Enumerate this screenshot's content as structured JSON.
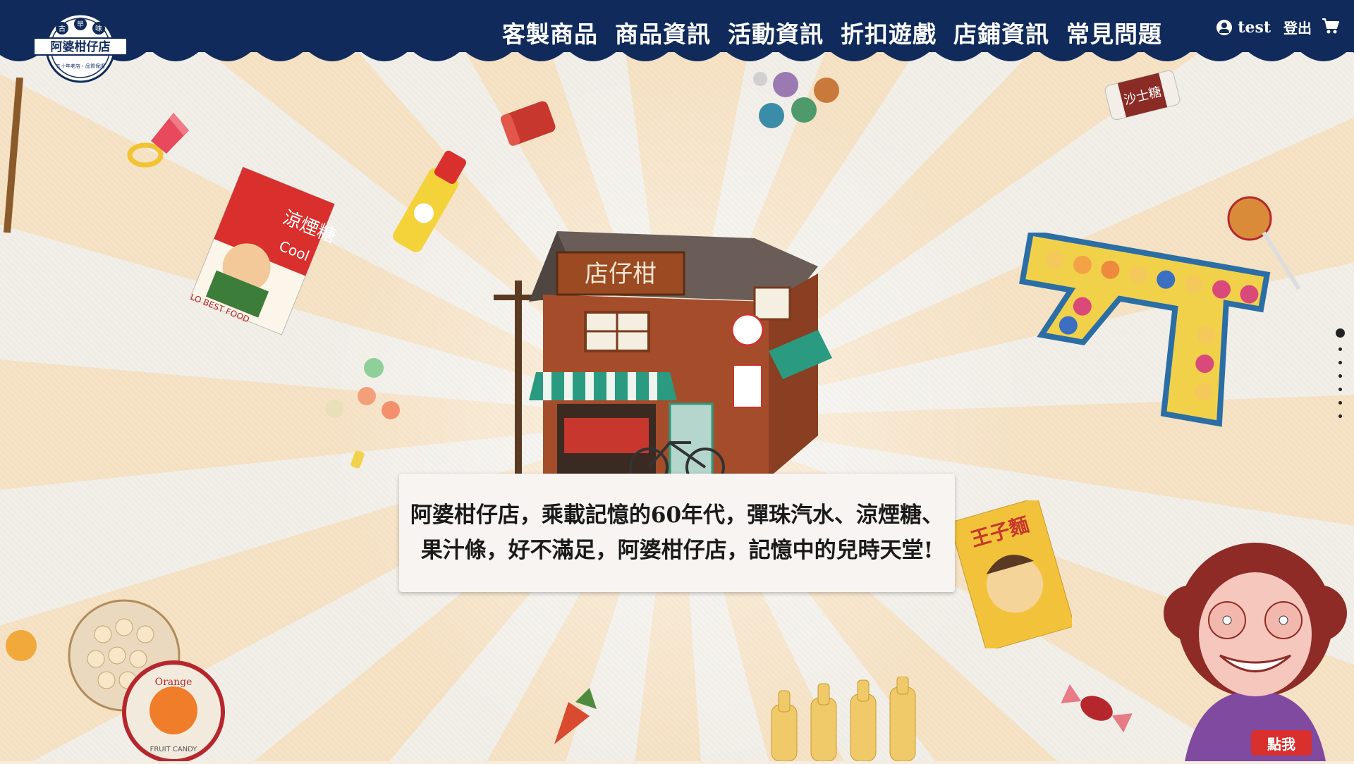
{
  "brand": {
    "logo_top_char_left": "古",
    "logo_top_char_mid": "早",
    "logo_top_char_right": "味",
    "logo_name": "阿婆柑仔店",
    "logo_tagline": "五十年老店・品質保證"
  },
  "nav": {
    "items": [
      "客製商品",
      "商品資訊",
      "活動資訊",
      "折扣遊戲",
      "店鋪資訊",
      "常見問題"
    ]
  },
  "user": {
    "username": "test",
    "logout_label": "登出",
    "user_icon": "user-circle-icon",
    "cart_icon": "cart-icon"
  },
  "hero": {
    "shop_sign": "店仔柑",
    "caption": "阿婆柑仔店，乘載記憶的60年代，彈珠汽水、涼煙糖、果汁條，好不滿足，阿婆柑仔店，記憶中的兒時天堂!"
  },
  "decorations": {
    "candy_box_label": "涼煙糖",
    "candy_box_sub": "Cool",
    "candy_box_brand": "LO BEST FOOD",
    "snack_bag_label": "王子麵",
    "wrapper_label": "沙士糖",
    "tin_label": "Orange",
    "tin_sub": "FRUIT CANDY"
  },
  "pagination": {
    "count": 7,
    "active_index": 0
  },
  "grandma_button": {
    "label": "點我"
  },
  "colors": {
    "header": "#102b5b",
    "caption_bg": "#f7f4f1",
    "accent_red": "#d9302d"
  }
}
